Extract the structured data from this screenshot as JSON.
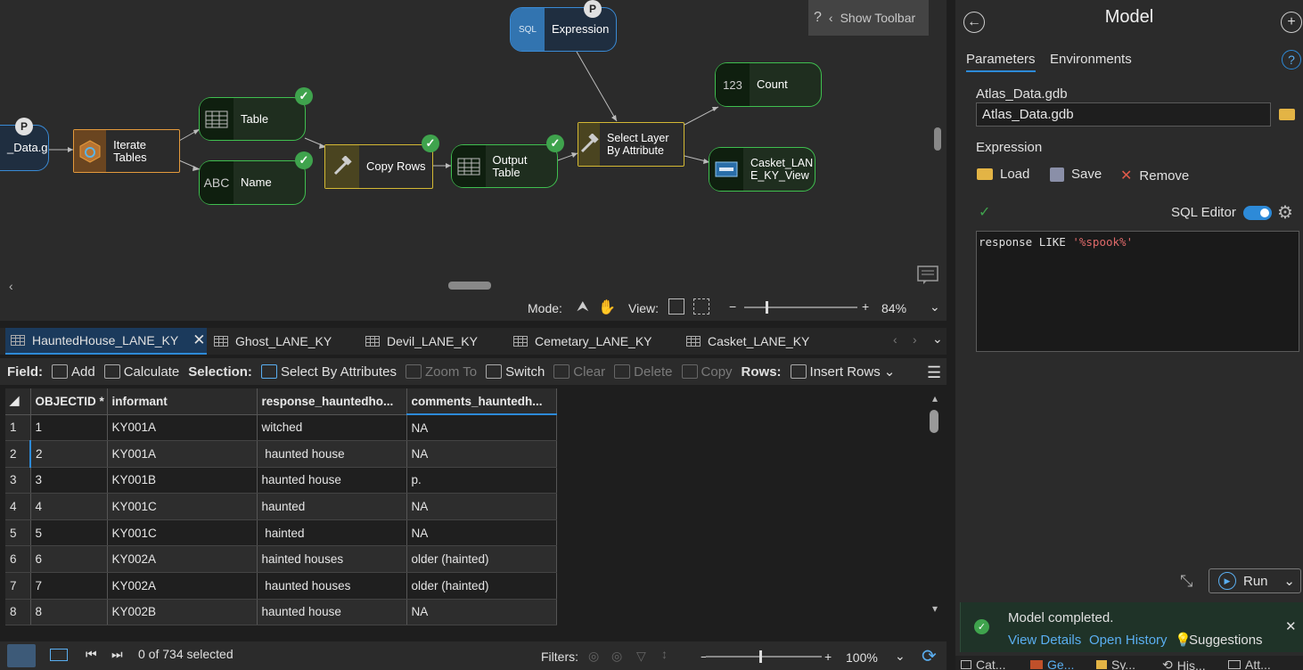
{
  "canvas": {
    "show_toolbar": "Show Toolbar",
    "help_glyph": "?",
    "nodes": {
      "data_g": "_Data.g",
      "iterate_tables": "Iterate Tables",
      "table": "Table",
      "name": "Name",
      "copy_rows": "Copy Rows",
      "output_table": "Output Table",
      "expression": "Expression",
      "select_layer": "Select Layer By Attribute",
      "count": "Count",
      "casket_view": "Casket_LAN E_KY_View"
    },
    "node_icons": {
      "expression_icon": "SQL",
      "count_icon": "123",
      "name_icon": "ABC"
    },
    "p_badge": "P",
    "check": "✓"
  },
  "mode_bar": {
    "mode_label": "Mode:",
    "view_label": "View:",
    "zoom": "84%",
    "minus": "−",
    "plus": "+"
  },
  "tabs": [
    {
      "label": "HauntedHouse_LANE_KY",
      "active": true
    },
    {
      "label": "Ghost_LANE_KY"
    },
    {
      "label": "Devil_LANE_KY"
    },
    {
      "label": "Cemetary_LANE_KY"
    },
    {
      "label": "Casket_LANE_KY"
    }
  ],
  "toolbar": {
    "field_label": "Field:",
    "add": "Add",
    "calculate": "Calculate",
    "selection_label": "Selection:",
    "select_by_attributes": "Select By Attributes",
    "zoom_to": "Zoom To",
    "switch": "Switch",
    "clear": "Clear",
    "delete": "Delete",
    "copy": "Copy",
    "rows_label": "Rows:",
    "insert_rows": "Insert Rows"
  },
  "grid": {
    "headers": [
      "OBJECTID *",
      "informant",
      "response_hauntedho...",
      "comments_hauntedh..."
    ],
    "rows": [
      [
        "1",
        "1",
        "KY001A",
        "witched",
        "NA"
      ],
      [
        "2",
        "2",
        "KY001A",
        " haunted house",
        "NA"
      ],
      [
        "3",
        "3",
        "KY001B",
        "haunted house",
        "p."
      ],
      [
        "4",
        "4",
        "KY001C",
        "haunted",
        "NA"
      ],
      [
        "5",
        "5",
        "KY001C",
        " hainted",
        "NA"
      ],
      [
        "6",
        "6",
        "KY002A",
        "hainted houses",
        "older (hainted)"
      ],
      [
        "7",
        "7",
        "KY002A",
        " haunted houses",
        "older (hainted)"
      ],
      [
        "8",
        "8",
        "KY002B",
        "haunted house",
        "NA"
      ]
    ]
  },
  "status": {
    "selected": "0 of 734 selected",
    "filters_label": "Filters:",
    "zoom": "100%"
  },
  "panel": {
    "title": "Model",
    "tabs": [
      "Parameters",
      "Environments"
    ],
    "gdb_label": "Atlas_Data.gdb",
    "gdb_value": "Atlas_Data.gdb",
    "expression_label": "Expression",
    "load": "Load",
    "save": "Save",
    "remove": "Remove",
    "sql_editor": "SQL Editor",
    "sql_keyword": "response LIKE ",
    "sql_string": "'%spook%'",
    "run": "Run",
    "notification": {
      "message": "Model completed.",
      "view_details": "View Details",
      "open_history": "Open History",
      "suggestions": "Suggestions"
    },
    "bottom_tabs": [
      "Cat...",
      "Ge...",
      "Sy...",
      "His...",
      "Att..."
    ]
  },
  "colors": {
    "accent": "#2d8ad8",
    "success": "#3fa34d",
    "tool_border": "#d4b934",
    "data_border": "#3fbf4f"
  }
}
